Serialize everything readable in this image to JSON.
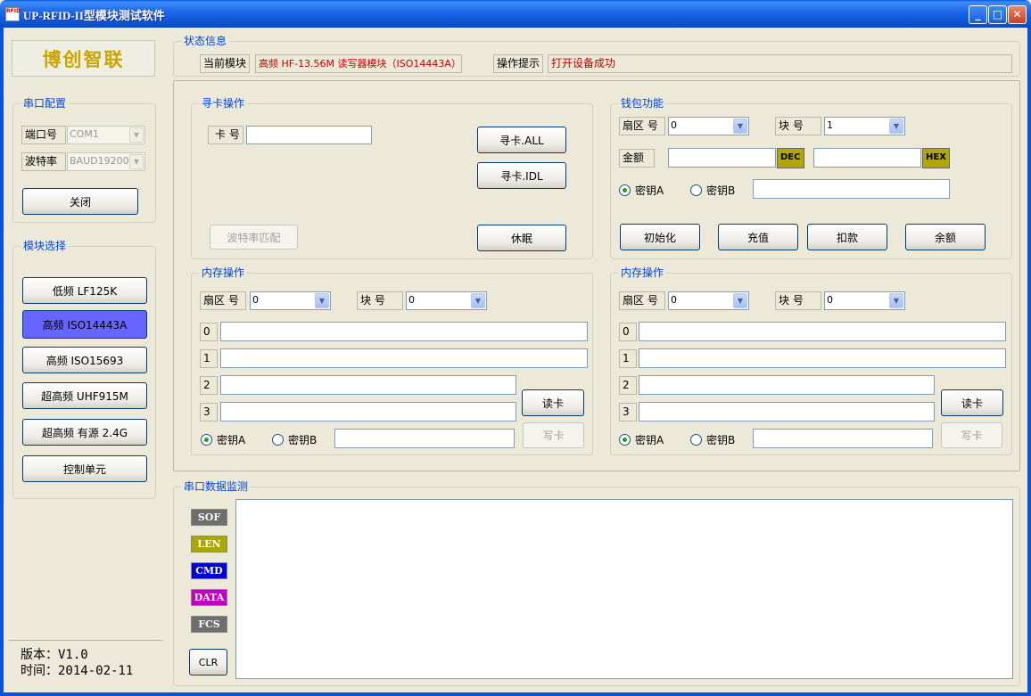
{
  "window": {
    "title": "UP-RFID-II型模块测试软件",
    "icon_text": "RFID"
  },
  "logo": "博创智联",
  "serial_config": {
    "title": "串口配置",
    "port_label": "端口号",
    "port_value": "COM1",
    "baud_label": "波特率",
    "baud_value": "BAUD19200",
    "close_button": "关闭"
  },
  "module_select": {
    "title": "模块选择",
    "buttons": [
      "低频 LF125K",
      "高频 ISO14443A",
      "高频 ISO15693",
      "超高频 UHF915M",
      "超高频 有源 2.4G",
      "控制单元"
    ],
    "active_index": 1
  },
  "version": {
    "version_text": "版本：V1.0",
    "date_text": "时间：2014-02-11"
  },
  "status": {
    "title": "状态信息",
    "current_module_label": "当前模块",
    "current_module_value": "高频 HF-13.56M 读写器模块（ISO14443A）",
    "hint_label": "操作提示",
    "hint_value": "打开设备成功"
  },
  "find_card": {
    "title": "寻卡操作",
    "card_no_label": "卡 号",
    "card_no_value": "",
    "find_all_button": "寻卡.ALL",
    "find_idl_button": "寻卡.IDL",
    "baud_match_button": "波特率匹配",
    "sleep_button": "休眠"
  },
  "wallet": {
    "title": "钱包功能",
    "sector_label": "扇区 号",
    "sector_value": "0",
    "block_label": "块 号",
    "block_value": "1",
    "amount_label": "金额",
    "dec_label": "DEC",
    "hex_label": "HEX",
    "key_a": "密钥A",
    "key_b": "密钥B",
    "init_button": "初始化",
    "recharge_button": "充值",
    "deduct_button": "扣款",
    "balance_button": "余额"
  },
  "memory_left": {
    "title": "内存操作",
    "sector_label": "扇区 号",
    "sector_value": "0",
    "block_label": "块 号",
    "block_value": "0",
    "rows": [
      "0",
      "1",
      "2",
      "3"
    ],
    "key_a": "密钥A",
    "key_b": "密钥B",
    "read_button": "读卡",
    "write_button": "写卡"
  },
  "memory_right": {
    "title": "内存操作",
    "sector_label": "扇区 号",
    "sector_value": "0",
    "block_label": "块 号",
    "block_value": "0",
    "rows": [
      "0",
      "1",
      "2",
      "3"
    ],
    "key_a": "密钥A",
    "key_b": "密钥B",
    "read_button": "读卡",
    "write_button": "写卡"
  },
  "monitor": {
    "title": "串口数据监测",
    "tags": [
      {
        "label": "SOF",
        "color": "#6e6e6e"
      },
      {
        "label": "LEN",
        "color": "#a8a800"
      },
      {
        "label": "CMD",
        "color": "#0000d0"
      },
      {
        "label": "DATA",
        "color": "#c000c0"
      },
      {
        "label": "FCS",
        "color": "#6e6e6e"
      }
    ],
    "clear_button": "CLR"
  }
}
